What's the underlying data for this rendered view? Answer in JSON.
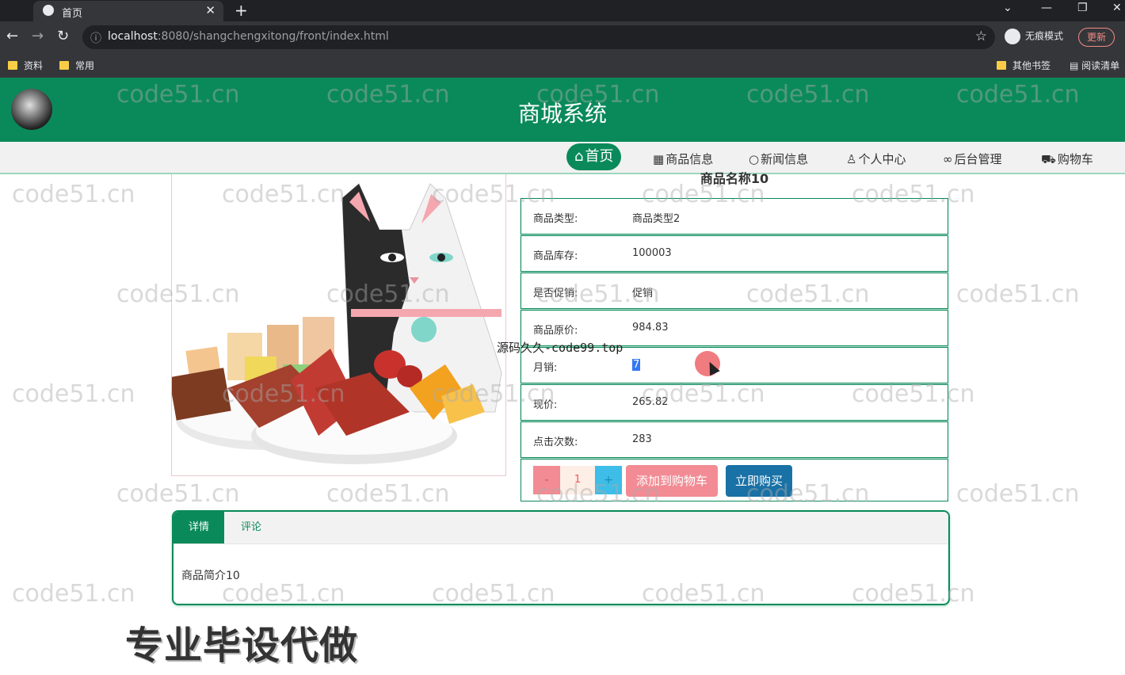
{
  "browser": {
    "tab_title": "首页",
    "url_host": "localhost",
    "url_rest": ":8080/shangchengxitong/front/index.html",
    "incognito_label": "无痕模式",
    "update_label": "更新",
    "bookmarks": [
      "资料",
      "常用"
    ],
    "bookmarks_right": [
      "其他书签",
      "阅读清单"
    ]
  },
  "site": {
    "title": "商城系统",
    "nav": [
      {
        "label": "首页",
        "icon": "home-icon"
      },
      {
        "label": "商品信息",
        "icon": "goods-icon"
      },
      {
        "label": "新闻信息",
        "icon": "news-icon"
      },
      {
        "label": "个人中心",
        "icon": "user-icon"
      },
      {
        "label": "后台管理",
        "icon": "link-icon"
      },
      {
        "label": "购物车",
        "icon": "cart-icon"
      }
    ]
  },
  "product": {
    "name": "商品名称10",
    "fields": [
      {
        "label": "商品类型:",
        "value": "商品类型2"
      },
      {
        "label": "商品库存:",
        "value": "100003"
      },
      {
        "label": "是否促销:",
        "value": "促销"
      },
      {
        "label": "商品原价:",
        "value": "984.83"
      },
      {
        "label": "月销:",
        "value": "7"
      },
      {
        "label": "现价:",
        "value": "265.82"
      },
      {
        "label": "点击次数:",
        "value": "283"
      }
    ],
    "quantity": "1",
    "minus_label": "-",
    "plus_label": "+",
    "add_cart_label": "添加到购物车",
    "buy_now_label": "立即购买"
  },
  "detail_tabs": {
    "tabs": [
      "详情",
      "评论"
    ],
    "description": "商品简介10"
  },
  "overlay": {
    "watermark": "code51.cn",
    "center_watermark": "源码久久-code99.top",
    "promo": "专业毕设代做"
  },
  "colors": {
    "brand": "#0a8a5a",
    "add_cart": "#f28b94",
    "buy_now": "#1971a6",
    "plus": "#3dbde8",
    "minus": "#f28b94"
  }
}
